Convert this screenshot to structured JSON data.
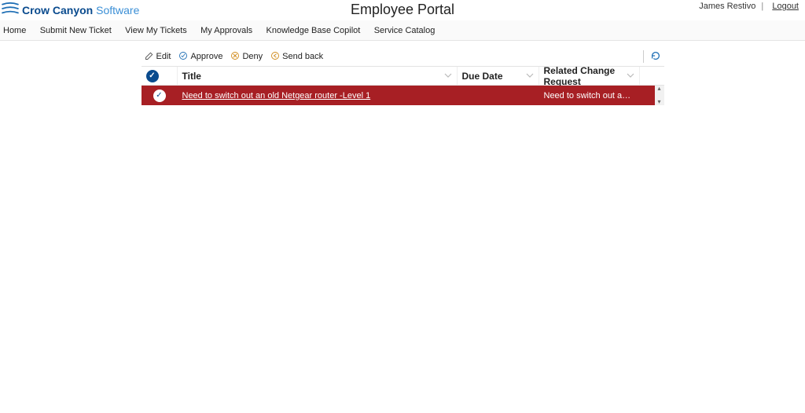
{
  "brand": {
    "name_strong": "Crow Canyon",
    "name_light": "Software"
  },
  "page_title": "Employee Portal",
  "user": {
    "name": "James Restivo",
    "logout": "Logout"
  },
  "nav": {
    "home": "Home",
    "submit": "Submit New Ticket",
    "view": "View My Tickets",
    "approvals": "My Approvals",
    "kb": "Knowledge Base Copilot",
    "catalog": "Service Catalog"
  },
  "toolbar": {
    "edit": "Edit",
    "approve": "Approve",
    "deny": "Deny",
    "sendback": "Send back"
  },
  "columns": {
    "title": "Title",
    "due": "Due Date",
    "related": "Related Change Request"
  },
  "rows": [
    {
      "selected": true,
      "title": "Need to switch out an old Netgear router -Level 1",
      "due": "",
      "related": "Need to switch out an old Netge..."
    }
  ]
}
